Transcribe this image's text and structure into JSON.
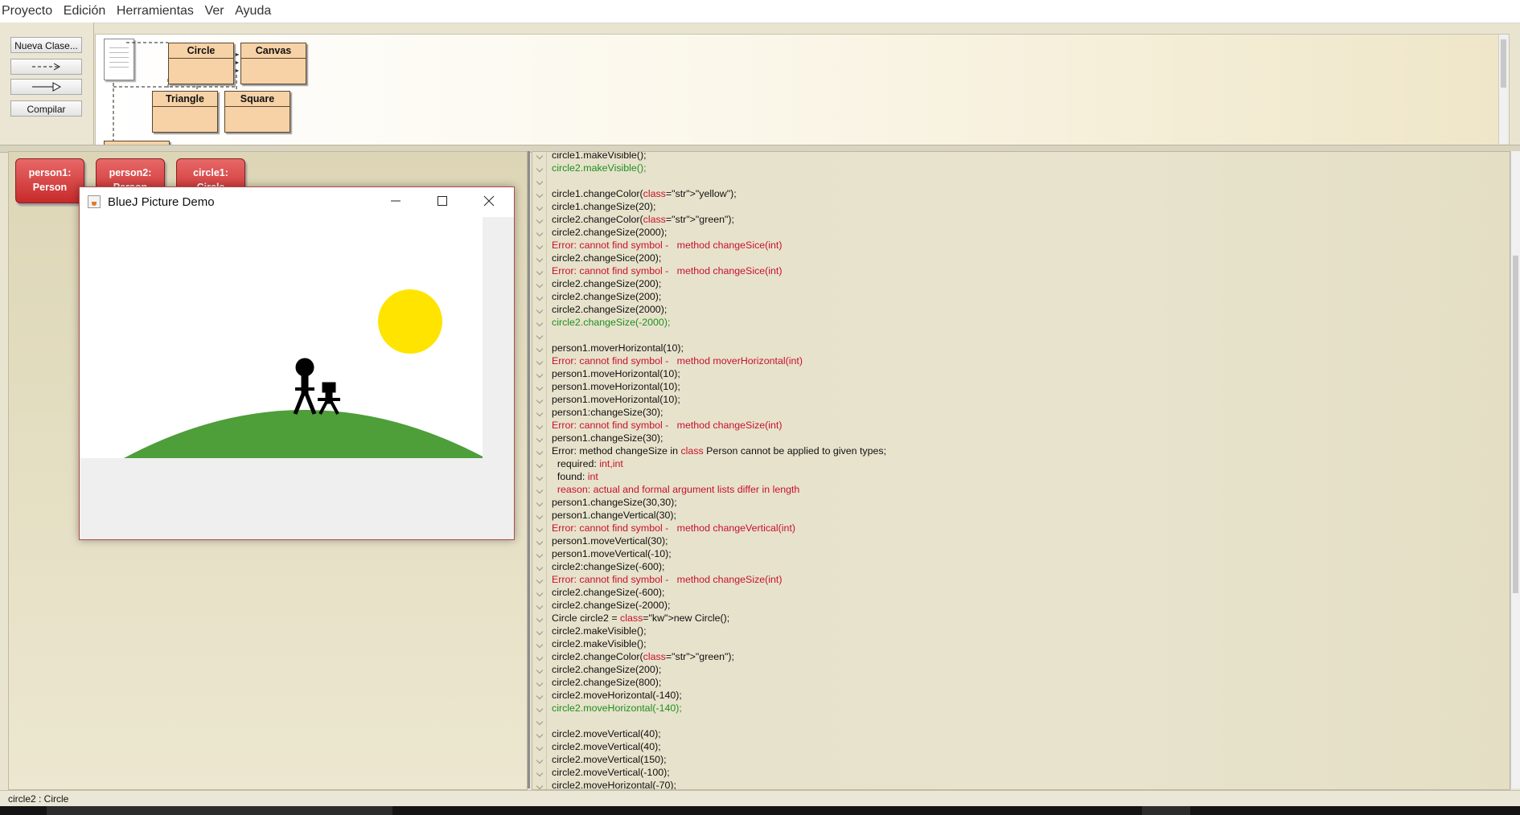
{
  "menu": [
    "Proyecto",
    "Edición",
    "Herramientas",
    "Ver",
    "Ayuda"
  ],
  "toolbar": {
    "new_class": "Nueva Clase...",
    "uses_arrow": "--->",
    "inherits_arrow": "—▷",
    "compile": "Compilar"
  },
  "diagram": {
    "classes": [
      "Circle",
      "Canvas",
      "Triangle",
      "Square"
    ]
  },
  "objects": [
    {
      "name": "person1:",
      "type": "Person"
    },
    {
      "name": "person2:",
      "type": "Person"
    },
    {
      "name": "circle1:",
      "type": "Circle"
    }
  ],
  "picture_window": {
    "title": "BlueJ Picture Demo",
    "colors": {
      "sun": "#ffe400",
      "hill": "#4e9e3a",
      "figure": "#000000"
    }
  },
  "code_lines": [
    {
      "t": "circle1.makeVisible();",
      "k": "code"
    },
    {
      "t": "circle2.makeVisible();",
      "k": "res"
    },
    {
      "t": "",
      "k": "code"
    },
    {
      "t": "circle1.changeColor(\"yellow\");",
      "k": "code"
    },
    {
      "t": "circle1.changeSize(20);",
      "k": "code"
    },
    {
      "t": "circle2.changeColor(\"green\");",
      "k": "code"
    },
    {
      "t": "circle2.changeSize(2000);",
      "k": "code"
    },
    {
      "t": "Error: cannot find symbol -   method changeSice(int)",
      "k": "err"
    },
    {
      "t": "circle2.changeSice(200);",
      "k": "code"
    },
    {
      "t": "Error: cannot find symbol -   method changeSice(int)",
      "k": "err"
    },
    {
      "t": "circle2.changeSize(200);",
      "k": "code"
    },
    {
      "t": "circle2.changeSize(200);",
      "k": "code"
    },
    {
      "t": "circle2.changeSize(2000);",
      "k": "code"
    },
    {
      "t": "circle2.changeSize(-2000);",
      "k": "res"
    },
    {
      "t": "",
      "k": "code"
    },
    {
      "t": "person1.moverHorizontal(10);",
      "k": "code"
    },
    {
      "t": "Error: cannot find symbol -   method moverHorizontal(int)",
      "k": "err"
    },
    {
      "t": "person1.moveHorizontal(10);",
      "k": "code"
    },
    {
      "t": "person1.moveHorizontal(10);",
      "k": "code"
    },
    {
      "t": "person1.moveHorizontal(10);",
      "k": "code"
    },
    {
      "t": "person1:changeSize(30);",
      "k": "code"
    },
    {
      "t": "Error: cannot find symbol -   method changeSize(int)",
      "k": "err"
    },
    {
      "t": "person1.changeSize(30);",
      "k": "code"
    },
    {
      "t": "Error: method changeSize in class Person cannot be applied to given types;",
      "k": "code"
    },
    {
      "t": "  required: int,int",
      "k": "code"
    },
    {
      "t": "  found: int",
      "k": "code"
    },
    {
      "t": "  reason: actual and formal argument lists differ in length",
      "k": "err"
    },
    {
      "t": "person1.changeSize(30,30);",
      "k": "code"
    },
    {
      "t": "person1.changeVertical(30);",
      "k": "code"
    },
    {
      "t": "Error: cannot find symbol -   method changeVertical(int)",
      "k": "err"
    },
    {
      "t": "person1.moveVertical(30);",
      "k": "code"
    },
    {
      "t": "person1.moveVertical(-10);",
      "k": "code"
    },
    {
      "t": "circle2:changeSize(-600);",
      "k": "code"
    },
    {
      "t": "Error: cannot find symbol -   method changeSize(int)",
      "k": "err"
    },
    {
      "t": "circle2.changeSize(-600);",
      "k": "code"
    },
    {
      "t": "circle2.changeSize(-2000);",
      "k": "code"
    },
    {
      "t": "Circle circle2 = new Circle();",
      "k": "code"
    },
    {
      "t": "circle2.makeVisible();",
      "k": "code"
    },
    {
      "t": "circle2.makeVisible();",
      "k": "code"
    },
    {
      "t": "circle2.changeColor(\"green\");",
      "k": "code"
    },
    {
      "t": "circle2.changeSize(200);",
      "k": "code"
    },
    {
      "t": "circle2.changeSize(800);",
      "k": "code"
    },
    {
      "t": "circle2.moveHorizontal(-140);",
      "k": "code"
    },
    {
      "t": "circle2.moveHorizontal(-140);",
      "k": "res"
    },
    {
      "t": "",
      "k": "code"
    },
    {
      "t": "circle2.moveVertical(40);",
      "k": "code"
    },
    {
      "t": "circle2.moveVertical(40);",
      "k": "code"
    },
    {
      "t": "circle2.moveVertical(150);",
      "k": "code"
    },
    {
      "t": "circle2.moveVertical(-100);",
      "k": "code"
    },
    {
      "t": "circle2.moveHorizontal(-70);",
      "k": "code"
    }
  ],
  "status": "circle2 : Circle"
}
